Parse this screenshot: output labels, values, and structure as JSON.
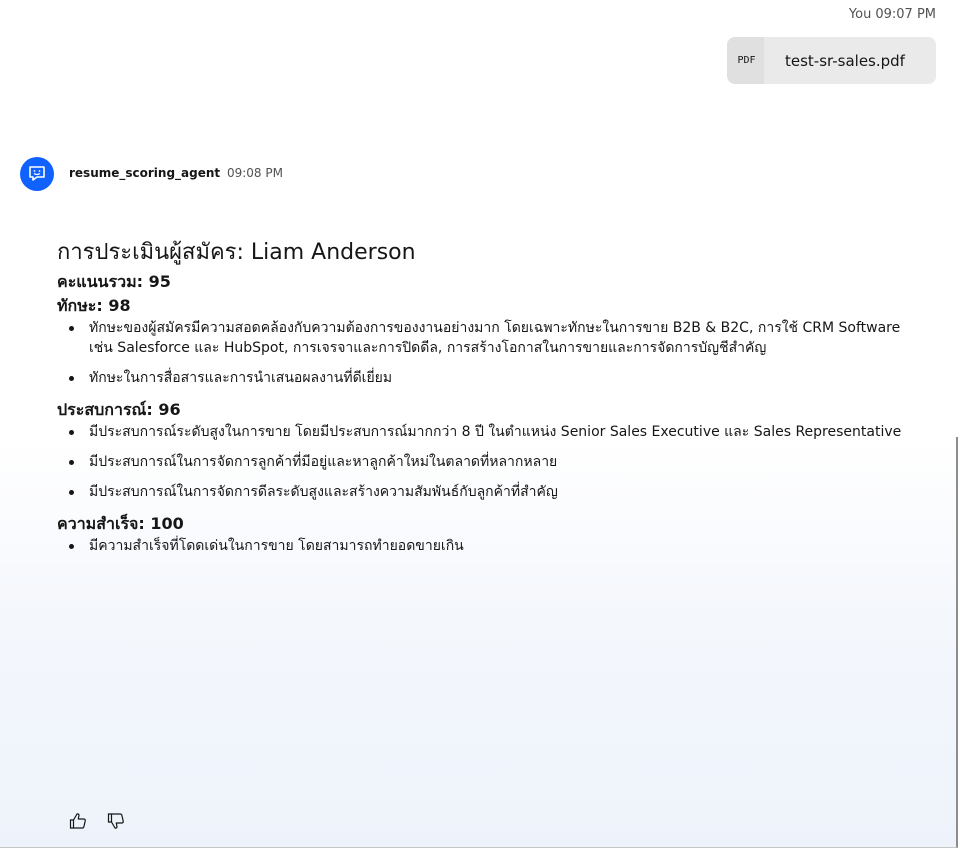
{
  "user_message": {
    "sender": "You",
    "time": "09:07 PM",
    "attachment": {
      "type_label": "PDF",
      "file_name": "test-sr-sales.pdf"
    }
  },
  "agent_message": {
    "agent_name": "resume_scoring_agent",
    "time": "09:08 PM",
    "avatar_icon": "chat-bubble-icon",
    "accent_color": "#0f62fe",
    "title": "การประเมินผู้สมัคร: Liam Anderson",
    "overall_score": "คะแนนรวม: 95",
    "sections": [
      {
        "heading": "ทักษะ: 98",
        "bullets": [
          "ทักษะของผู้สมัครมีความสอดคล้องกับความต้องการของงานอย่างมาก โดยเฉพาะทักษะในการขาย B2B & B2C, การใช้ CRM Software เช่น Salesforce และ HubSpot, การเจรจาและการปิดดีล, การสร้างโอกาสในการขายและการจัดการบัญชีสำคัญ",
          "ทักษะในการสื่อสารและการนำเสนอผลงานที่ดีเยี่ยม"
        ]
      },
      {
        "heading": "ประสบการณ์: 96",
        "bullets": [
          "มีประสบการณ์ระดับสูงในการขาย โดยมีประสบการณ์มากกว่า 8 ปี ในตำแหน่ง Senior Sales Executive และ Sales Representative",
          "มีประสบการณ์ในการจัดการลูกค้าที่มีอยู่และหาลูกค้าใหม่ในตลาดที่หลากหลาย",
          "มีประสบการณ์ในการจัดการดีลระดับสูงและสร้างความสัมพันธ์กับลูกค้าที่สำคัญ"
        ]
      },
      {
        "heading": "ความสำเร็จ: 100",
        "bullets": [
          "มีความสำเร็จที่โดดเด่นในการขาย โดยสามารถทำยอดขายเกิน"
        ]
      }
    ],
    "feedback": {
      "thumbs_up_icon": "thumbs-up-icon",
      "thumbs_down_icon": "thumbs-down-icon"
    }
  }
}
